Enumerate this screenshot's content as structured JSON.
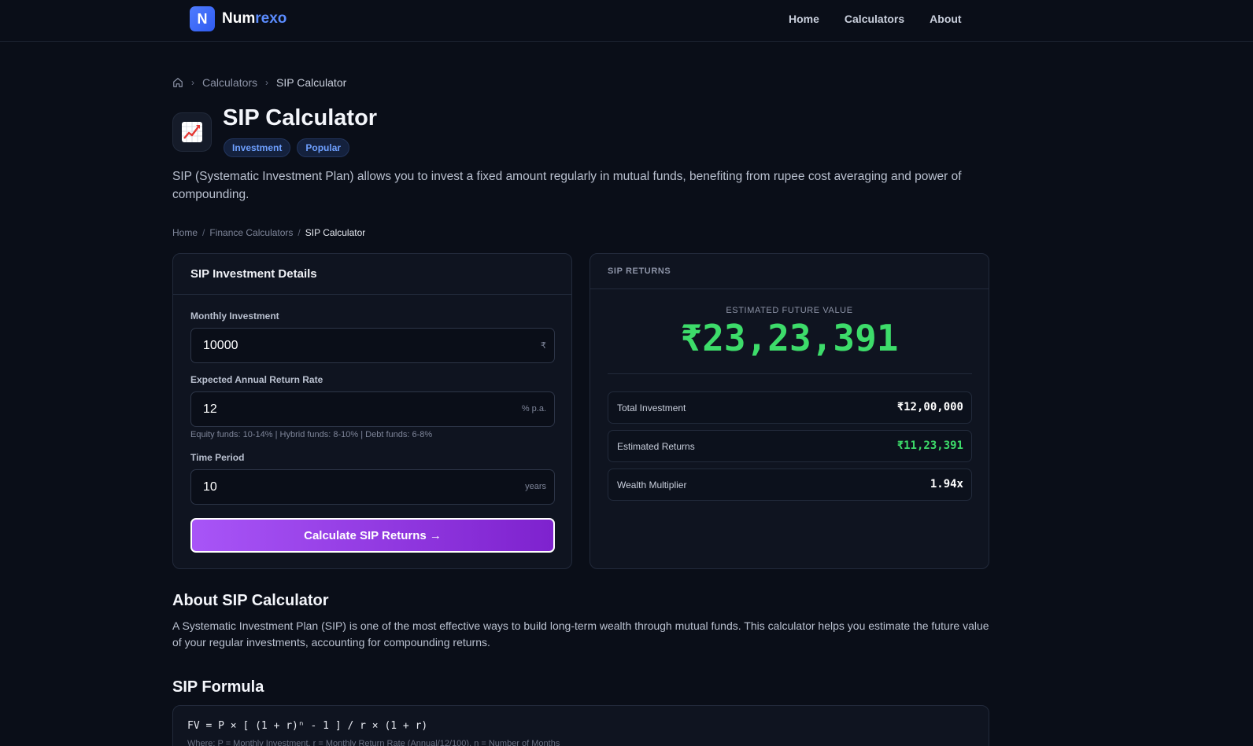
{
  "brand": {
    "mark": "N",
    "name_part1": "Num",
    "name_part2": "rexo"
  },
  "nav": {
    "home": "Home",
    "calculators": "Calculators",
    "about": "About"
  },
  "breadcrumb_top": {
    "calculators": "Calculators",
    "current": "SIP Calculator"
  },
  "header": {
    "title": "SIP Calculator",
    "tags": [
      "Investment",
      "Popular"
    ],
    "description": "SIP (Systematic Investment Plan) allows you to invest a fixed amount regularly in mutual funds, benefiting from rupee cost averaging and power of compounding."
  },
  "breadcrumb_secondary": {
    "home": "Home",
    "finance": "Finance Calculators",
    "current": "SIP Calculator"
  },
  "form": {
    "title": "SIP Investment Details",
    "monthly_label": "Monthly Investment",
    "monthly_value": "10000",
    "monthly_suffix": "₹",
    "rate_label": "Expected Annual Return Rate",
    "rate_value": "12",
    "rate_suffix": "% p.a.",
    "rate_hint": "Equity funds: 10-14% | Hybrid funds: 8-10% | Debt funds: 6-8%",
    "period_label": "Time Period",
    "period_value": "10",
    "period_suffix": "years",
    "button_label": "Calculate SIP Returns →"
  },
  "results": {
    "title": "SIP RETURNS",
    "fv_label": "ESTIMATED FUTURE VALUE",
    "fv_value": "₹23,23,391",
    "total_investment_label": "Total Investment",
    "total_investment_value": "₹12,00,000",
    "returns_label": "Estimated Returns",
    "returns_value": "₹11,23,391",
    "multiplier_label": "Wealth Multiplier",
    "multiplier_value": "1.94x"
  },
  "about": {
    "title": "About SIP Calculator",
    "text": "A Systematic Investment Plan (SIP) is one of the most effective ways to build long-term wealth through mutual funds. This calculator helps you estimate the future value of your regular investments, accounting for compounding returns."
  },
  "formula": {
    "title": "SIP Formula",
    "expression": "FV = P × [ (1 + r)ⁿ - 1 ] / r × (1 + r)",
    "note": "Where: P = Monthly Investment, r = Monthly Return Rate (Annual/12/100), n = Number of Months"
  },
  "colors": {
    "accent_green": "#3ddc6a",
    "accent_purple": "#a855f7",
    "accent_blue": "#5b8cff"
  }
}
